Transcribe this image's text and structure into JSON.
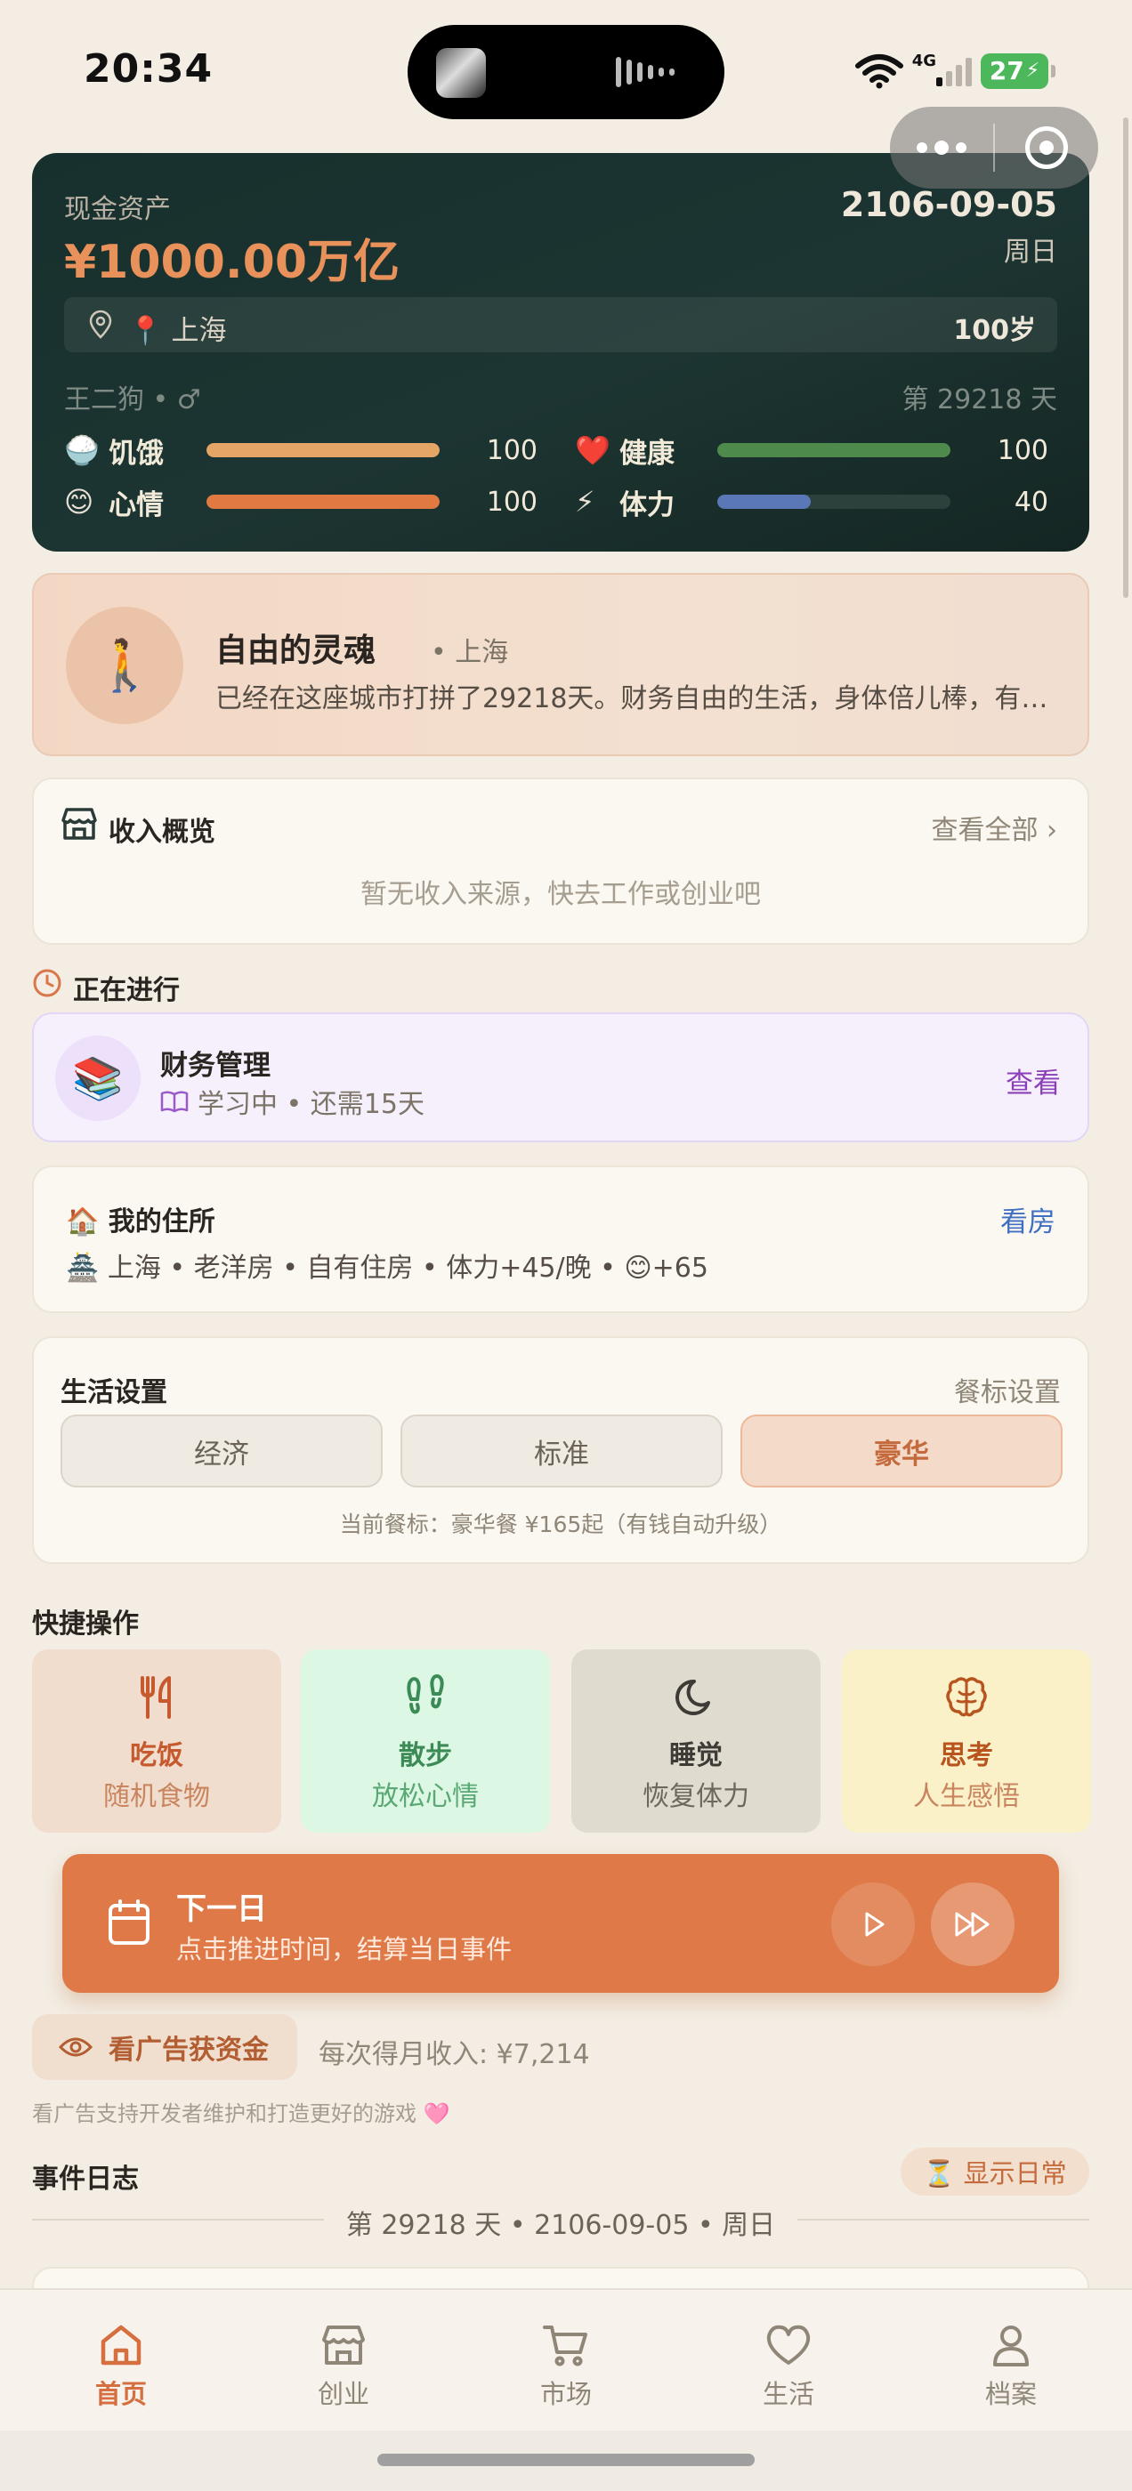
{
  "status_bar": {
    "time": "20:34",
    "network": "4G",
    "battery": "27"
  },
  "hero": {
    "cash_label": "现金资产",
    "cash_value": "¥1000.00万亿",
    "date": "2106-09-05",
    "weekday": "周日",
    "city": "📍 上海",
    "age": "100岁",
    "name_gender": "王二狗 • ♂",
    "day_count": "第 29218 天",
    "stats": [
      {
        "emoji": "🍚",
        "label": "饥饿",
        "value": "100",
        "level": 1.0,
        "color": "#e5a566"
      },
      {
        "emoji": "❤️",
        "label": "健康",
        "value": "100",
        "level": 1.0,
        "color": "#4f8a4d"
      },
      {
        "emoji": "😊",
        "label": "心情",
        "value": "100",
        "level": 1.0,
        "color": "#e07a42"
      },
      {
        "emoji": "⚡",
        "label": "体力",
        "value": "40",
        "level": 0.4,
        "color": "#5a78b8"
      }
    ]
  },
  "profile": {
    "avatar": "🚶",
    "title": "自由的灵魂",
    "location": "• 上海",
    "description": "已经在这座城市打拼了29218天。财务自由的生活，身体倍儿棒，有…"
  },
  "income": {
    "title": "收入概览",
    "view_all": "查看全部 ›",
    "empty": "暂无收入来源，快去工作或创业吧"
  },
  "in_progress": {
    "title": "正在进行",
    "task": {
      "icon": "📚",
      "name": "财务管理",
      "status": "学习中 • 还需15天",
      "action": "查看"
    }
  },
  "residence": {
    "title": "🏠 我的住所",
    "action": "看房",
    "detail": "🏯 上海 • 老洋房 • 自有住房 • 体力+45/晚 • 😊+65"
  },
  "life_settings": {
    "title": "生活设置",
    "meal_settings": "餐标设置",
    "options": [
      "经济",
      "标准",
      "豪华"
    ],
    "selected": "豪华",
    "note": "当前餐标：豪华餐 ¥165起（有钱自动升级）"
  },
  "quick_actions": {
    "title": "快捷操作",
    "items": [
      {
        "name": "吃饭",
        "sub": "随机食物",
        "icon": "fork-knife-icon"
      },
      {
        "name": "散步",
        "sub": "放松心情",
        "icon": "footprints-icon"
      },
      {
        "name": "睡觉",
        "sub": "恢复体力",
        "icon": "moon-icon"
      },
      {
        "name": "思考",
        "sub": "人生感悟",
        "icon": "brain-icon"
      }
    ]
  },
  "next_day": {
    "title": "下一日",
    "subtitle": "点击推进时间，结算当日事件"
  },
  "ads": {
    "button": "看广告获资金",
    "income": "每次得月收入: ¥7,214",
    "note": "看广告支持开发者维护和打造更好的游戏 🩷"
  },
  "event_log": {
    "title": "事件日志",
    "toggle": "⏳ 显示日常",
    "day_label": "第 29218 天 • 2106-09-05 • 周日"
  },
  "tabbar": {
    "items": [
      {
        "label": "首页",
        "icon": "home-icon",
        "active": true
      },
      {
        "label": "创业",
        "icon": "store-icon",
        "active": false
      },
      {
        "label": "市场",
        "icon": "cart-icon",
        "active": false
      },
      {
        "label": "生活",
        "icon": "heart-icon",
        "active": false
      },
      {
        "label": "档案",
        "icon": "person-icon",
        "active": false
      }
    ]
  },
  "colors": {
    "accent": "#df7a48",
    "hero_bg": "#1d3532",
    "page_bg": "#f3ede3"
  }
}
